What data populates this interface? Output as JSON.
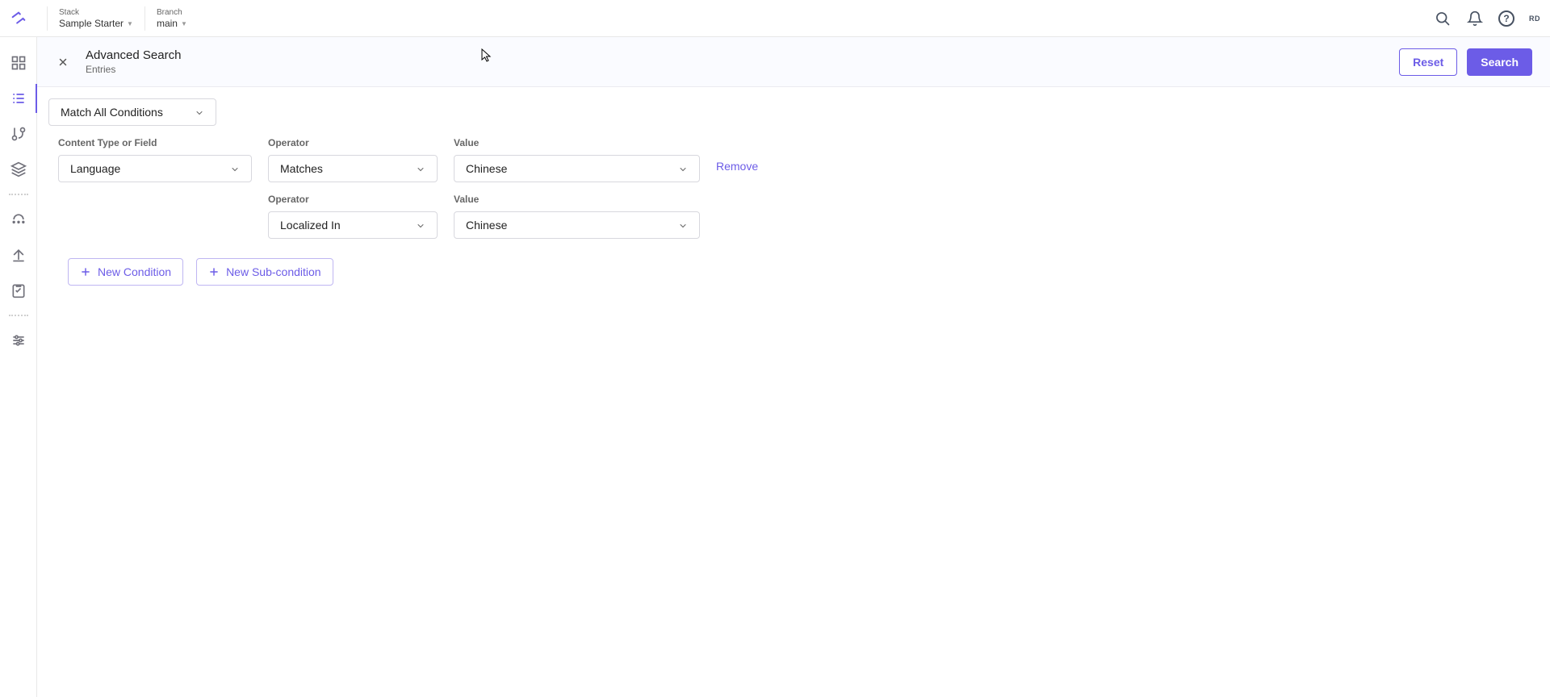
{
  "header": {
    "stack_label": "Stack",
    "stack_value": "Sample Starter",
    "branch_label": "Branch",
    "branch_value": "main",
    "user_initials": "RD"
  },
  "page": {
    "title": "Advanced Search",
    "subtitle": "Entries",
    "reset_label": "Reset",
    "search_label": "Search"
  },
  "match": {
    "selected": "Match All Conditions"
  },
  "labels": {
    "content_type": "Content Type or Field",
    "operator": "Operator",
    "value": "Value"
  },
  "conditions": {
    "row1": {
      "field": "Language",
      "operator": "Matches",
      "value": "Chinese",
      "remove_label": "Remove"
    },
    "row2": {
      "operator": "Localized In",
      "value": "Chinese"
    }
  },
  "actions": {
    "new_condition": "New Condition",
    "new_sub_condition": "New Sub-condition"
  }
}
